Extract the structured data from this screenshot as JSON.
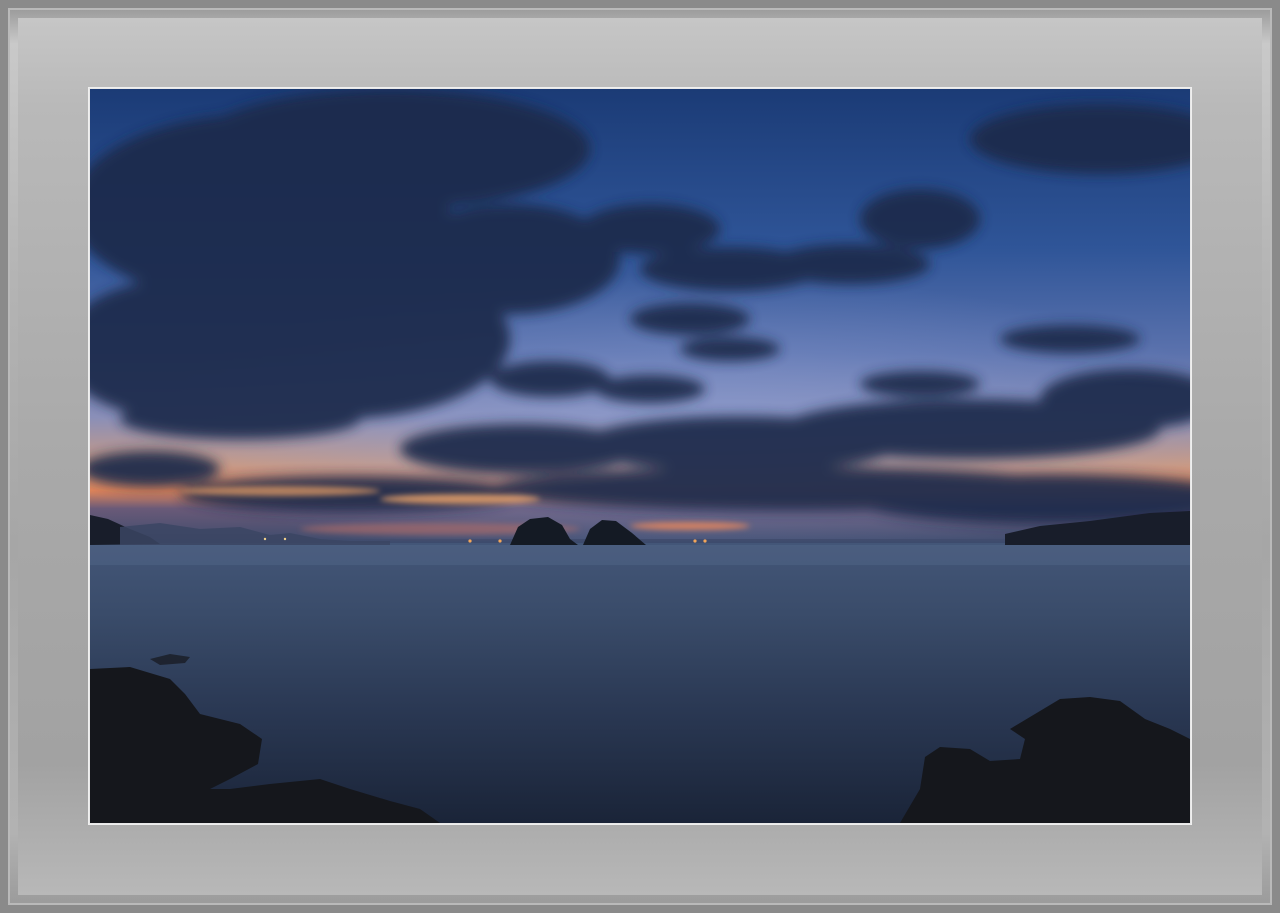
{
  "image": {
    "subject": "seascape-at-dusk",
    "colors": {
      "sky_top": "#1d3f7a",
      "sky_mid": "#4a69a8",
      "sky_horizon_glow": "#e88a4a",
      "cloud_dark": "#1f2d4d",
      "sea": "#2b3a55",
      "rock": "#15171c",
      "frame": "#a8a8a8"
    }
  }
}
